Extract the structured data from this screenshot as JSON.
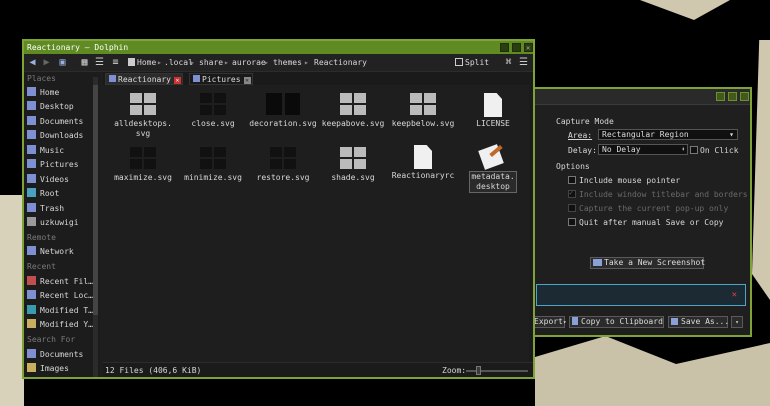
{
  "colors": {
    "accent": "#7fa337",
    "titlebar": "#5f8b22",
    "info_border": "#4da4c7"
  },
  "dolphin": {
    "title": "Reactionary — Dolphin",
    "toolbar": {
      "split_label": "Split"
    },
    "breadcrumb": [
      "Home",
      ".local",
      "share",
      "aurorae",
      "themes",
      "Reactionary"
    ],
    "tabs": [
      {
        "label": "Reactionary",
        "active": true
      },
      {
        "label": "Pictures",
        "active": false
      }
    ],
    "places_header": "Places",
    "places": [
      "Home",
      "Desktop",
      "Documents",
      "Downloads",
      "Music",
      "Pictures",
      "Videos",
      "Root",
      "Trash",
      "uzkuwigi"
    ],
    "remote_header": "Remote",
    "remote": [
      "Network"
    ],
    "recent_header": "Recent",
    "recent": [
      "Recent Fil…",
      "Recent Loc…",
      "Modified T…",
      "Modified Y…"
    ],
    "search_header": "Search For",
    "search": [
      "Documents",
      "Images"
    ],
    "files": [
      {
        "name": "alldesktops.\nsvg",
        "icon": "svg-thumbnail"
      },
      {
        "name": "close.svg",
        "icon": "svg-thumbnail"
      },
      {
        "name": "decoration.svg",
        "icon": "svg-thumbnail"
      },
      {
        "name": "keepabove.svg",
        "icon": "svg-thumbnail"
      },
      {
        "name": "keepbelow.svg",
        "icon": "svg-thumbnail"
      },
      {
        "name": "LICENSE",
        "icon": "text-file-icon"
      },
      {
        "name": "maximize.svg",
        "icon": "svg-thumbnail"
      },
      {
        "name": "minimize.svg",
        "icon": "svg-thumbnail"
      },
      {
        "name": "restore.svg",
        "icon": "svg-thumbnail"
      },
      {
        "name": "shade.svg",
        "icon": "svg-thumbnail"
      },
      {
        "name": "Reactionaryrc",
        "icon": "text-file-icon"
      },
      {
        "name": "metadata.\ndesktop",
        "icon": "desktop-file-icon"
      }
    ],
    "status_text": "12 Files (406,6 KiB)",
    "zoom_label": "Zoom:"
  },
  "spectacle": {
    "capture_mode_header": "Capture Mode",
    "area_label": "Area:",
    "area_value": "Rectangular Region",
    "delay_label": "Delay:",
    "delay_value": "No Delay",
    "on_click_label": "On Click",
    "options_header": "Options",
    "options": [
      {
        "label": "Include mouse pointer",
        "checked": false,
        "disabled": false
      },
      {
        "label": "Include window titlebar and borders",
        "checked": true,
        "disabled": true
      },
      {
        "label": "Capture the current pop-up only",
        "checked": false,
        "disabled": true
      },
      {
        "label": "Quit after manual Save or Copy",
        "checked": false,
        "disabled": false
      }
    ],
    "take_screenshot_label": "Take a New Screenshot",
    "export_label": "Export",
    "copy_label": "Copy to Clipboard",
    "save_label": "Save As..."
  }
}
